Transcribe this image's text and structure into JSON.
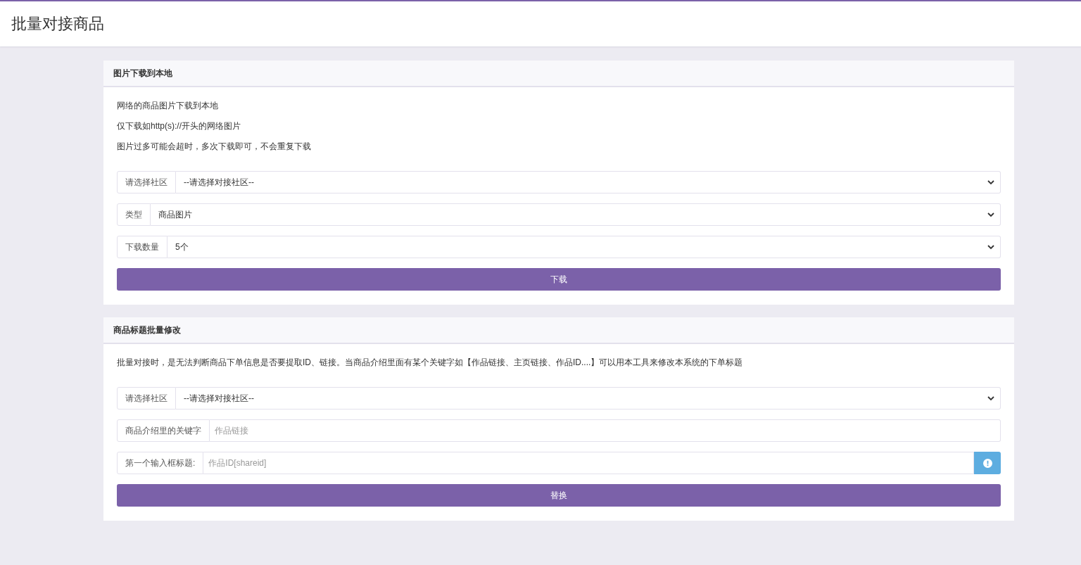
{
  "page": {
    "title": "批量对接商品"
  },
  "panels": [
    {
      "title": "图片下载到本地",
      "notes": [
        "网络的商品图片下载到本地",
        "仅下载如http(s)://开头的网络图片",
        "图片过多可能会超时，多次下载即可，不会重复下载"
      ],
      "fields": [
        {
          "kind": "select",
          "label": "请选择社区",
          "value": "--请选择对接社区--"
        },
        {
          "kind": "select",
          "label": "类型",
          "value": "商品图片"
        },
        {
          "kind": "select",
          "label": "下载数量",
          "value": "5个"
        }
      ],
      "button": "下载"
    },
    {
      "title": "商品标题批量修改",
      "notes": [
        "批量对接时，是无法判断商品下单信息是否要提取ID、链接。当商品介绍里面有某个关键字如【作品链接、主页链接、作品ID....】可以用本工具来修改本系统的下单标题"
      ],
      "fields": [
        {
          "kind": "select",
          "label": "请选择社区",
          "value": "--请选择对接社区--"
        },
        {
          "kind": "input",
          "label": "商品介绍里的关键字",
          "placeholder": "作品链接"
        },
        {
          "kind": "input_button",
          "label": "第一个输入框标题:",
          "placeholder": "作品ID[shareid]"
        }
      ],
      "button": "替换"
    }
  ]
}
